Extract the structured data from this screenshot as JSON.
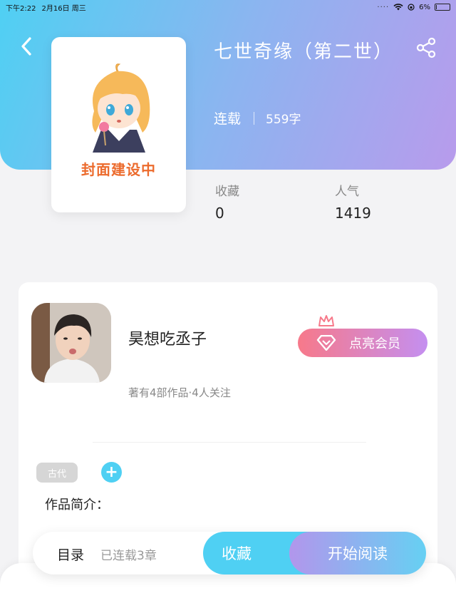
{
  "status_bar": {
    "time": "下午2:22",
    "date": "2月16日 周三",
    "battery": "6%",
    "battery_level": 0.06
  },
  "book": {
    "title": "七世奇缘（第二世）",
    "status": "连载",
    "word_count": "559字",
    "cover_text": "封面建设中"
  },
  "stats": [
    {
      "label": "收藏",
      "value": "0"
    },
    {
      "label": "人气",
      "value": "1419"
    }
  ],
  "author": {
    "name": "昊想吃丞子",
    "meta": "著有4部作品·4人关注"
  },
  "vip_button": {
    "label": "点亮会员"
  },
  "tags": [
    "古代"
  ],
  "intro_label": "作品简介：",
  "action_bar": {
    "catalog_label": "目录",
    "serial_info": "已连载3章",
    "favorite_label": "收藏",
    "read_label": "开始阅读"
  },
  "colors": {
    "accent_cyan": "#4fd0f3",
    "accent_purple": "#b89bec",
    "vip_pink": "#f7798a",
    "cover_text_orange": "#ec6b2d"
  }
}
